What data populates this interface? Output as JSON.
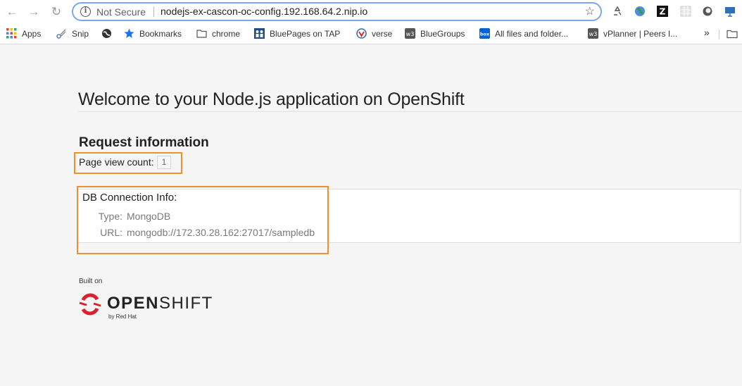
{
  "browser": {
    "security_label": "Not Secure",
    "url": "nodejs-ex-cascon-oc-config.192.168.64.2.nip.io",
    "bookmarks": [
      {
        "label": "Apps",
        "icon": "apps-grid-icon"
      },
      {
        "label": "Snip",
        "icon": "scissors-icon"
      },
      {
        "label": "",
        "icon": "globe-icon"
      },
      {
        "label": "Bookmarks",
        "icon": "star-icon"
      },
      {
        "label": "chrome",
        "icon": "folder-icon"
      },
      {
        "label": "BluePages on TAP",
        "icon": "bluepages-icon"
      },
      {
        "label": "verse",
        "icon": "verse-icon"
      },
      {
        "label": "BlueGroups",
        "icon": "w3-icon"
      },
      {
        "label": "All files and folder...",
        "icon": "box-icon"
      },
      {
        "label": "vPlanner | Peers I...",
        "icon": "w3-icon"
      }
    ],
    "overflow_label": "»"
  },
  "page": {
    "title": "Welcome to your Node.js application on OpenShift",
    "section_title": "Request information",
    "page_view_label": "Page view count:",
    "page_view_count": "1",
    "db": {
      "title": "DB Connection Info:",
      "type_label": "Type:",
      "type_value": "MongoDB",
      "url_label": "URL:",
      "url_value": "mongodb://172.30.28.162:27017/sampledb"
    },
    "built_on": "Built on",
    "logo_text_bold": "OPEN",
    "logo_text_light": "SHIFT",
    "logo_sub": "by Red Hat"
  },
  "colors": {
    "highlight": "#f0902a",
    "openshift_red": "#db212e"
  }
}
